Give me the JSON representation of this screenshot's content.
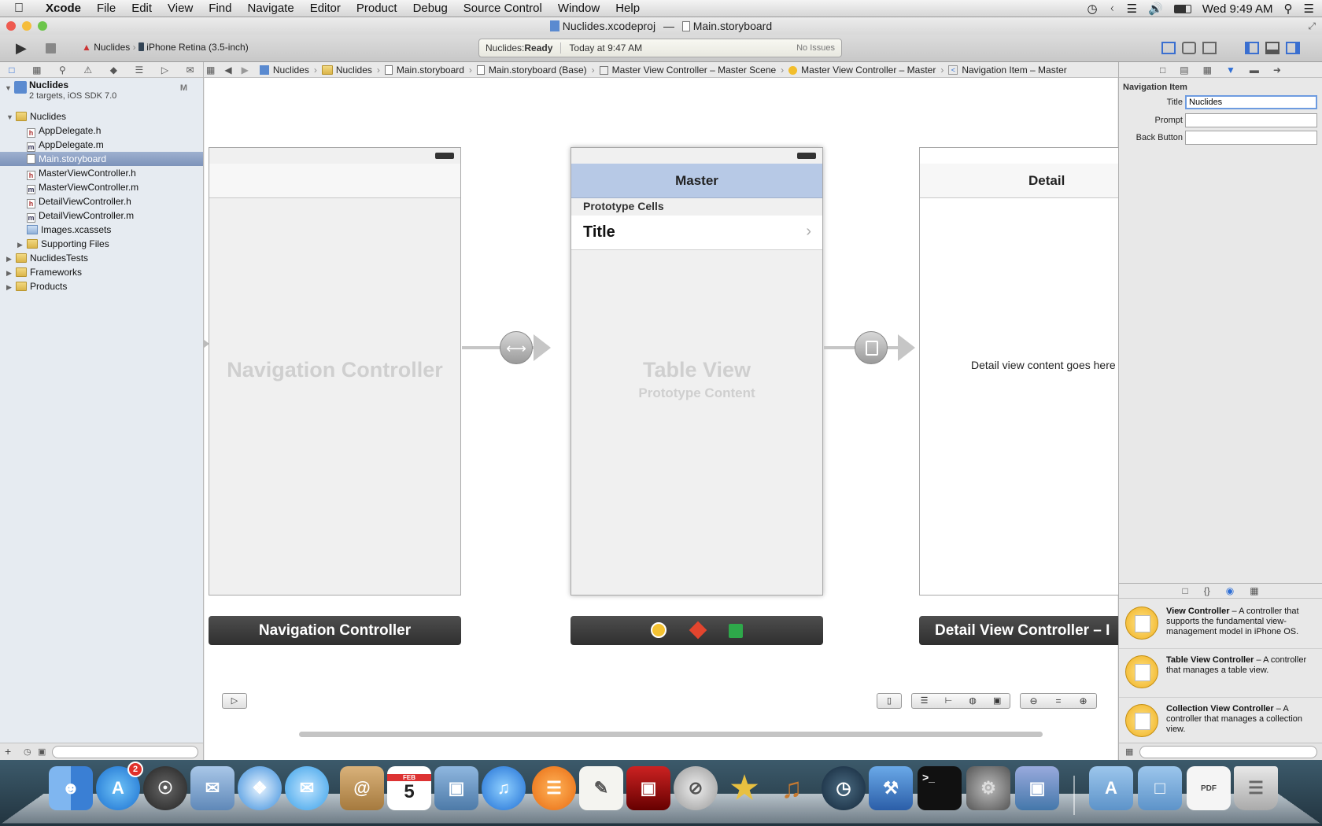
{
  "menubar": {
    "items": [
      "Xcode",
      "File",
      "Edit",
      "View",
      "Find",
      "Navigate",
      "Editor",
      "Product",
      "Debug",
      "Source Control",
      "Window",
      "Help"
    ],
    "clock": "Wed 9:49 AM"
  },
  "window": {
    "title_project": "Nuclides.xcodeproj",
    "title_sep": "—",
    "title_file": "Main.storyboard"
  },
  "toolbar": {
    "scheme": "Nuclides",
    "device": "iPhone Retina (3.5-inch)",
    "status_prefix": "Nuclides: ",
    "status": "Ready",
    "status_time": "Today at 9:47 AM",
    "issues": "No Issues"
  },
  "jumpbar": [
    "Nuclides",
    "Nuclides",
    "Main.storyboard",
    "Main.storyboard (Base)",
    "Master View Controller – Master Scene",
    "Master View Controller – Master",
    "Navigation Item – Master"
  ],
  "navigator": {
    "project_name": "Nuclides",
    "project_sub": "2 targets, iOS SDK 7.0",
    "project_badge": "M",
    "items": [
      {
        "label": "Nuclides",
        "type": "folder",
        "indent": 1,
        "disclosure": "open"
      },
      {
        "label": "AppDelegate.h",
        "type": "h",
        "indent": 2
      },
      {
        "label": "AppDelegate.m",
        "type": "m",
        "indent": 2
      },
      {
        "label": "Main.storyboard",
        "type": "sb",
        "indent": 2,
        "selected": true
      },
      {
        "label": "MasterViewController.h",
        "type": "h",
        "indent": 2
      },
      {
        "label": "MasterViewController.m",
        "type": "m",
        "indent": 2
      },
      {
        "label": "DetailViewController.h",
        "type": "h",
        "indent": 2
      },
      {
        "label": "DetailViewController.m",
        "type": "m",
        "indent": 2
      },
      {
        "label": "Images.xcassets",
        "type": "assets",
        "indent": 2
      },
      {
        "label": "Supporting Files",
        "type": "folder",
        "indent": 2,
        "disclosure": "closed"
      },
      {
        "label": "NuclidesTests",
        "type": "folder",
        "indent": 1,
        "disclosure": "closed"
      },
      {
        "label": "Frameworks",
        "type": "folder",
        "indent": 1,
        "disclosure": "closed"
      },
      {
        "label": "Products",
        "type": "folder",
        "indent": 1,
        "disclosure": "closed"
      }
    ]
  },
  "canvas": {
    "nav_scene_placeholder": "Navigation Controller",
    "nav_scene_label": "Navigation Controller",
    "master_title": "Master",
    "prototype_cells": "Prototype Cells",
    "cell_title": "Title",
    "table_placeholder": "Table View",
    "table_sub": "Prototype Content",
    "detail_title": "Detail",
    "detail_content": "Detail view content goes here",
    "detail_label": "Detail View Controller – I"
  },
  "inspector": {
    "section": "Navigation Item",
    "title_label": "Title",
    "title_value": "Nuclides",
    "prompt_label": "Prompt",
    "prompt_value": "",
    "back_label": "Back Button",
    "back_value": ""
  },
  "library": [
    {
      "name": "View Controller",
      "desc": " – A controller that supports the fundamental view-management model in iPhone OS."
    },
    {
      "name": "Table View Controller",
      "desc": " – A controller that manages a table view."
    },
    {
      "name": "Collection View Controller",
      "desc": " – A controller that manages a collection view."
    }
  ],
  "dock": {
    "appstore_badge": "2",
    "calendar_month": "FEB",
    "calendar_day": "5"
  },
  "colors": {
    "selection": "#7d93ba",
    "nav_bar_selected": "#b7c9e6"
  }
}
